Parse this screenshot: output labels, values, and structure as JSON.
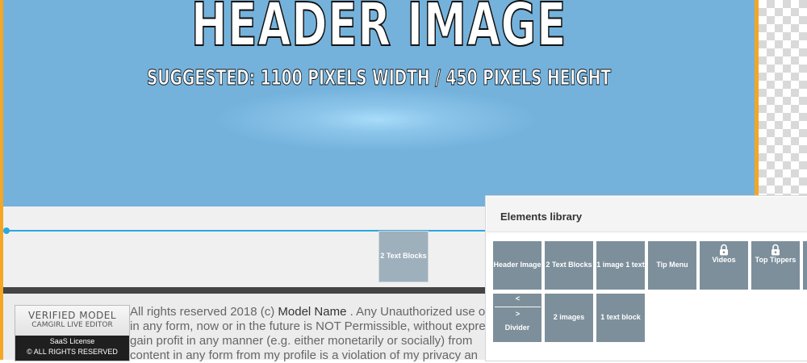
{
  "header_image": {
    "title": "HEADER IMAGE",
    "subtitle": "SUGGESTED: 1100 PIXELS WIDTH / 450 PIXELS HEIGHT"
  },
  "drag_ghost": {
    "label": "2 Text Blocks"
  },
  "footer": {
    "badge": {
      "verified": "VERIFIED MODEL",
      "editor": "CAMGIRL LIVE EDITOR",
      "license": "SaaS License",
      "rights": "© ALL RIGHTS RESERVED"
    },
    "text_prefix": "All rights reserved 2018 (c) ",
    "model_name": "Model Name",
    "text_line1_suffix": " . Any Unauthorized use o",
    "text_line2": "in any form, now or in the future is NOT Permissible, without expres",
    "text_line3": "gain profit in any manner (e.g. either monetarily or socially) from",
    "text_line4": "content in any form from my profile is a violation of my privacy an"
  },
  "elements_library": {
    "title": "Elements library",
    "row1": [
      {
        "label": "Header Image",
        "locked": false
      },
      {
        "label": "2 Text Blocks",
        "locked": false
      },
      {
        "label": "1 image 1 text",
        "locked": false
      },
      {
        "label": "Tip Menu",
        "locked": false
      },
      {
        "label": "Videos",
        "locked": true,
        "icon": "lock-icon"
      },
      {
        "label": "Top Tippers",
        "locked": true,
        "icon": "lock-icon"
      }
    ],
    "row2": [
      {
        "label": "Divider",
        "icon": "double-arrow-icon",
        "arrow": "<———————>"
      },
      {
        "label": "2 images"
      },
      {
        "label": "1 text block"
      }
    ]
  },
  "colors": {
    "header_bg": "#74b2dc",
    "tile_bg": "#7d8f9b",
    "accent_orange": "#f5a623",
    "drop_line": "#29a8e0"
  }
}
